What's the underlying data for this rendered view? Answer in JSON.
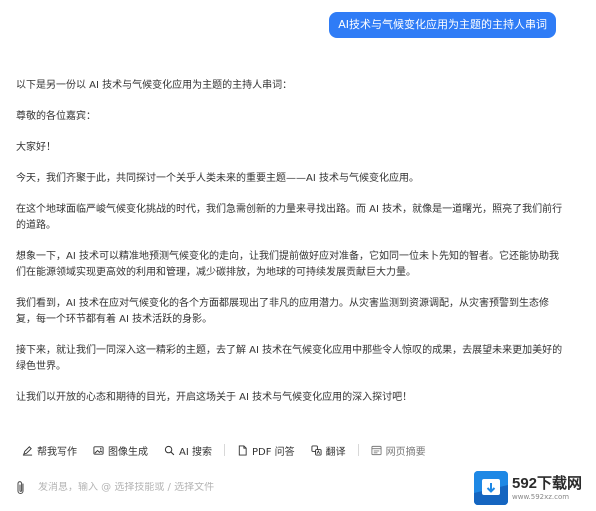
{
  "user_message": "AI技术与气候变化应用为主题的主持人串词",
  "answer": {
    "paragraphs": [
      "以下是另一份以 AI 技术与气候变化应用为主题的主持人串词：",
      "尊敬的各位嘉宾：",
      "大家好！",
      "今天，我们齐聚于此，共同探讨一个关乎人类未来的重要主题——AI 技术与气候变化应用。",
      "在这个地球面临严峻气候变化挑战的时代，我们急需创新的力量来寻找出路。而 AI 技术，就像是一道曙光，照亮了我们前行的道路。",
      "想象一下，AI 技术可以精准地预测气候变化的走向，让我们提前做好应对准备，它如同一位未卜先知的智者。它还能协助我们在能源领域实现更高效的利用和管理，减少碳排放，为地球的可持续发展贡献巨大力量。",
      "我们看到，AI 技术在应对气候变化的各个方面都展现出了非凡的应用潜力。从灾害监测到资源调配，从灾害预警到生态修复，每一个环节都有着 AI 技术活跃的身影。",
      "接下来，就让我们一同深入这一精彩的主题，去了解 AI 技术在气候变化应用中那些令人惊叹的成果，去展望未来更加美好的绿色世界。",
      "让我们以开放的心态和期待的目光，开启这场关于 AI 技术与气候变化应用的深入探讨吧！"
    ]
  },
  "toolbar": {
    "items": [
      {
        "label": "帮我写作",
        "icon": "pen-icon"
      },
      {
        "label": "图像生成",
        "icon": "image-icon"
      },
      {
        "label": "AI 搜索",
        "icon": "search-icon"
      },
      {
        "label": "PDF 问答",
        "icon": "pdf-icon"
      },
      {
        "label": "翻译",
        "icon": "translate-icon"
      },
      {
        "label": "网页摘要",
        "icon": "webpage-icon"
      }
    ]
  },
  "input": {
    "placeholder": "发消息，输入 @ 选择技能或 / 选择文件",
    "value": ""
  },
  "watermark": {
    "title": "592下载网",
    "subtitle": "www.592xz.com"
  },
  "colors": {
    "accent": "#2f7cf6",
    "text": "#333333"
  }
}
